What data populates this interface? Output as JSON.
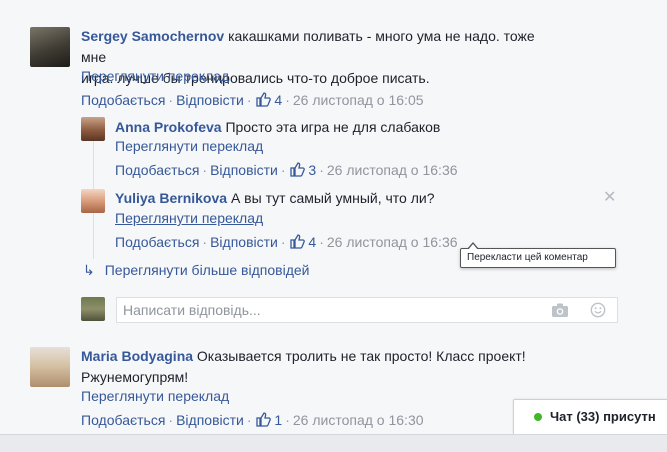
{
  "comments": [
    {
      "author": "Sergey Samochernov",
      "text_line1": "какашками поливать - много ума не надо. тоже мне",
      "text_line2": "игра. лучше бы тренировались что-то доброе писать.",
      "see_translation": "Переглянути переклад",
      "like_label": "Подобається",
      "reply_label": "Відповісти",
      "likes": "4",
      "timestamp": "26 листопад о 16:05"
    },
    {
      "author": "Maria Bodyagina",
      "text_line1": "Оказывается тролить не так просто! Класс проект!",
      "text_line2": "Ржунемогупрям!",
      "see_translation": "Переглянути переклад",
      "like_label": "Подобається",
      "reply_label": "Відповісти",
      "likes": "1",
      "timestamp": "26 листопад о 16:30"
    }
  ],
  "replies": [
    {
      "author": "Anna Prokofeva",
      "text": "Просто эта игра не для слабаков",
      "see_translation": "Переглянути переклад",
      "like_label": "Подобається",
      "reply_label": "Відповісти",
      "likes": "3",
      "timestamp": "26 листопад о 16:36"
    },
    {
      "author": "Yuliya Bernikova",
      "text": "А вы тут самый умный, что ли?",
      "see_translation": "Переглянути переклад",
      "like_label": "Подобається",
      "reply_label": "Відповісти",
      "likes": "4",
      "timestamp": "26 листопад о 16:36"
    }
  ],
  "more_replies": "Переглянути більше відповідей",
  "reply_input": {
    "placeholder": "Написати відповідь..."
  },
  "tooltip": "Перекласти цей коментар",
  "chat": {
    "label": "Чат (33) присутн",
    "status_color": "#42b72a"
  },
  "colors": {
    "link": "#365899",
    "meta": "#90949c",
    "text": "#1d2129",
    "background": "#f6f7f9"
  },
  "icons": [
    "thumbs-up-icon",
    "close-icon",
    "reply-arrow-icon",
    "camera-icon",
    "smile-icon",
    "online-dot-icon"
  ]
}
